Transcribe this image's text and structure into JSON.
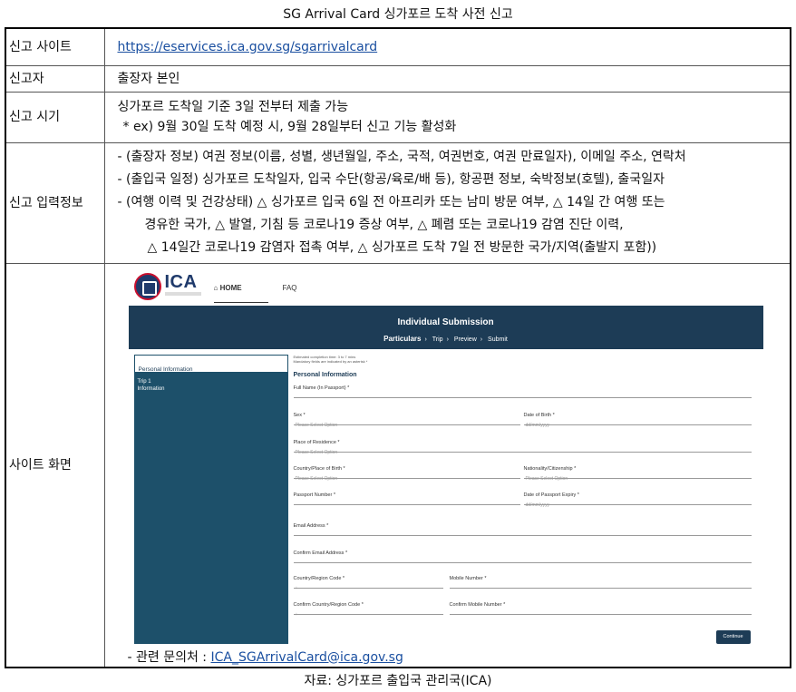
{
  "doc_title": "SG Arrival Card 싱가포르 도착 사전 신고",
  "rows": {
    "site_label": "신고 사이트",
    "site_url": "https://eservices.ica.gov.sg/sgarrivalcard",
    "reporter_label": "신고자",
    "reporter_value": "출장자 본인",
    "timing_label": "신고 시기",
    "timing_line1": "싱가포르 도착일 기준 3일 전부터 제출 가능",
    "timing_line2": "* ex) 9월 30일 도착 예정 시, 9월 28일부터 신고 기능 활성화",
    "input_label": "신고 입력정보",
    "input_lines": [
      "- (출장자 정보) 여권 정보(이름, 성별, 생년월일, 주소, 국적, 여권번호, 여권 만료일자), 이메일 주소, 연락처",
      "- (출입국 일정) 싱가포르 도착일자, 입국 수단(항공/육로/배 등), 항공편 정보, 숙박정보(호텔), 출국일자",
      "- (여행 이력 및 건강상태) △ 싱가포르 입국 6일 전 아프리카 또는 남미 방문 여부, △ 14일 간 여행 또는",
      "경유한 국가, △ 발열, 기침 등 코로나19 증상 여부, △ 폐렴 또는 코로나19 감염 진단 이력,",
      "△ 14일간 코로나19 감염자 접촉 여부, △ 싱가포르 도착 7일 전 방문한 국가/지역(출발지 포함))"
    ],
    "screen_label": "사이트 화면",
    "contact_prefix": "- 관련 문의처 : ",
    "contact_email": "ICA_SGArrivalCard@ica.gov.sg"
  },
  "screenshot": {
    "logo_text": "ICA",
    "nav_home": "HOME",
    "nav_faq": "FAQ",
    "banner_title": "Individual Submission",
    "steps": [
      "Particulars",
      "Trip",
      "Preview",
      "Submit"
    ],
    "sidebar_active": "Personal Information",
    "sidebar_trip": "Trip 1",
    "sidebar_trip2": "Information",
    "note1": "Estimated completion time: 3 to 7 mins",
    "note2": "Mandatory fields are indicated by an asterisk *",
    "section": "Personal Information",
    "fields": {
      "full_name": "Full Name (In Passport) *",
      "sex": "Sex *",
      "sex_ph": "Please Select Option",
      "dob": "Date of Birth *",
      "dob_ph": "dd/mm/yyyy",
      "residence": "Place of Residence *",
      "residence_ph": "Please Select Option",
      "country_birth": "Country/Place of Birth *",
      "country_birth_ph": "Please Select Option",
      "nationality": "Nationality/Citizenship *",
      "nationality_ph": "Please Select Option",
      "passport": "Passport Number *",
      "passport_expiry": "Date of Passport Expiry *",
      "passport_expiry_ph": "dd/mm/yyyy",
      "email": "Email Address *",
      "confirm_email": "Confirm Email Address *",
      "region_code": "Country/Region Code *",
      "region_code_ph": "+",
      "mobile": "Mobile Number *",
      "confirm_region": "Confirm Country/Region Code *",
      "confirm_region_ph": "+",
      "confirm_mobile": "Confirm Mobile Number *"
    },
    "continue": "Continue"
  },
  "source": "자료: 싱가포르 출입국 관리국(ICA)"
}
